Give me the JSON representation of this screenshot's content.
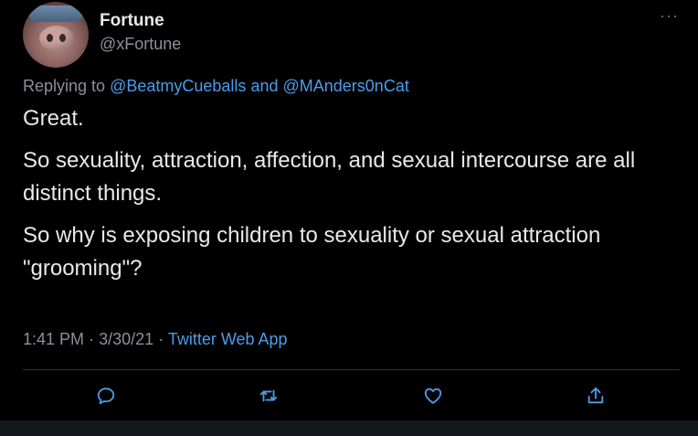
{
  "tweet": {
    "display_name": "Fortune",
    "handle": "@xFortune",
    "more_label": "···",
    "replying_prefix": "Replying to",
    "reply_to_1": "@BeatmyCueballs",
    "reply_joiner": "and",
    "reply_to_2": "@MAnders0nCat",
    "paragraphs": [
      "Great.",
      "So sexuality, attraction, affection, and sexual intercourse are all distinct things.",
      "So why is exposing children to sexuality or sexual attraction \"grooming\"?"
    ],
    "time": "1:41 PM",
    "separator": "·",
    "date": "3/30/21",
    "source": "Twitter Web App"
  },
  "actions": {
    "reply_icon": "reply-icon",
    "retweet_icon": "retweet-icon",
    "like_icon": "heart-icon",
    "share_icon": "share-icon"
  },
  "colors": {
    "background": "#000000",
    "text": "#e7e9ea",
    "secondary": "#8b9196",
    "link": "#4c9de8",
    "divider": "#2f3336"
  }
}
